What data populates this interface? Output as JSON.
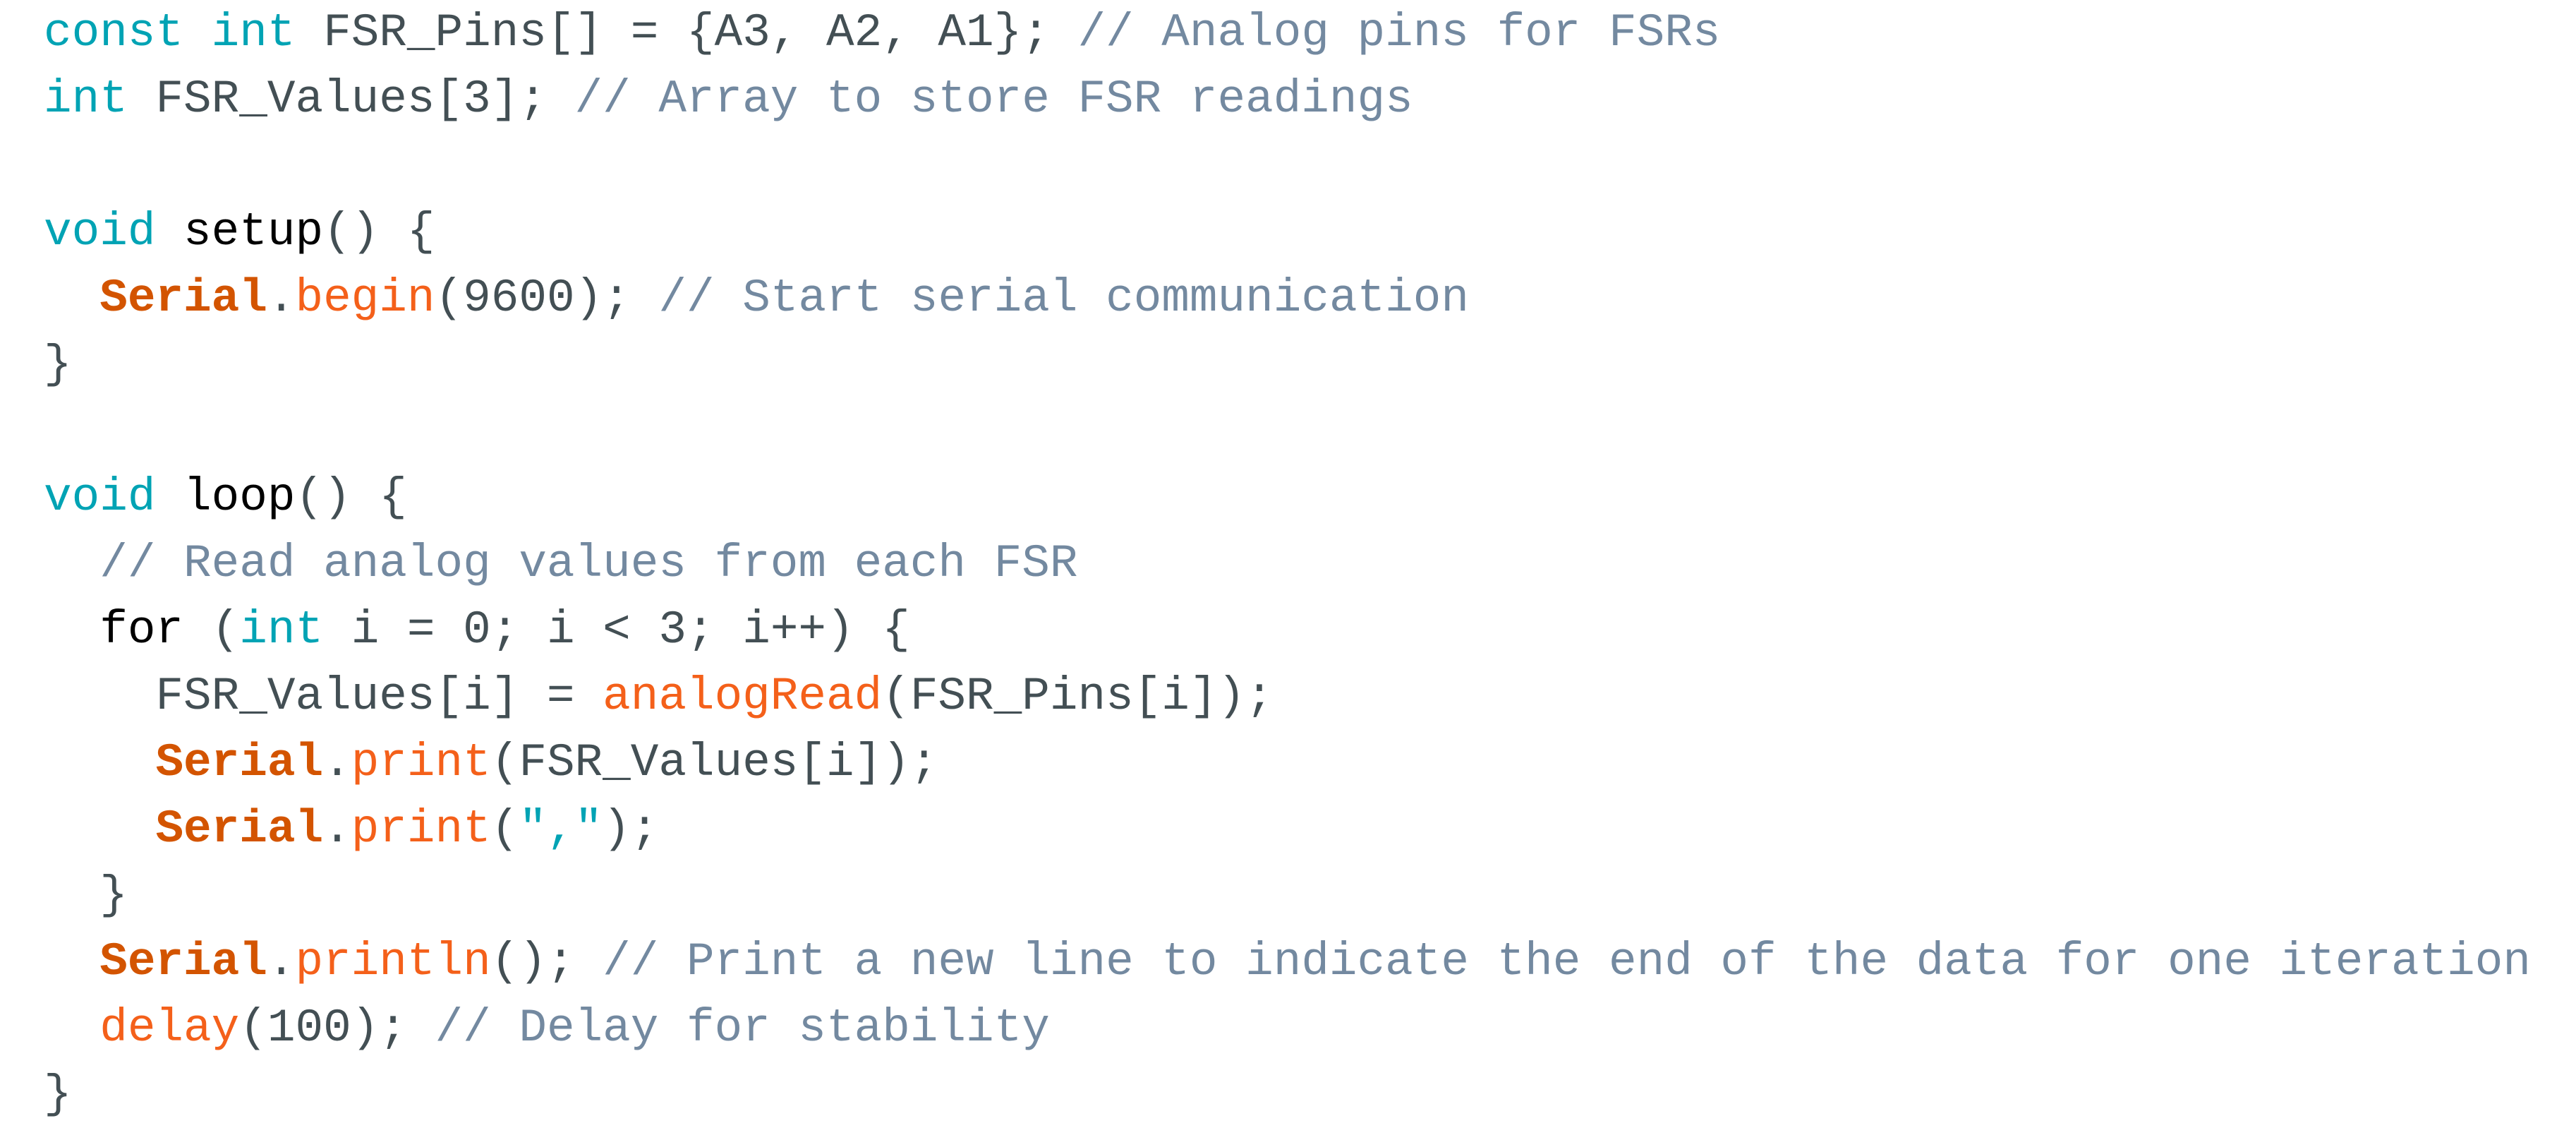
{
  "editor": {
    "language": "arduino-cpp",
    "background_color": "#ffffff",
    "colors": {
      "keyword": "#00A3B4",
      "function": "#7E7D2F",
      "plain": "#434f54",
      "comment": "#7389a0",
      "object": "#d35400",
      "method": "#f4601a",
      "string": "#00A3B4",
      "number": "#434f54"
    }
  },
  "code": {
    "lines": [
      {
        "id": "line-1",
        "tokens": [
          {
            "text": "const",
            "type": "keyword"
          },
          {
            "text": " ",
            "type": "plain"
          },
          {
            "text": "int",
            "type": "keyword"
          },
          {
            "text": " FSR_Pins[] = {A3, A2, A1}; ",
            "type": "plain"
          },
          {
            "text": "// Analog pins for FSRs",
            "type": "comment"
          }
        ]
      },
      {
        "id": "line-2",
        "tokens": [
          {
            "text": "int",
            "type": "keyword"
          },
          {
            "text": " FSR_Values[3]; ",
            "type": "plain"
          },
          {
            "text": "// Array to store FSR readings",
            "type": "comment"
          }
        ]
      },
      {
        "id": "line-3",
        "tokens": []
      },
      {
        "id": "line-4",
        "tokens": [
          {
            "text": "void",
            "type": "keyword"
          },
          {
            "text": " ",
            "type": "plain"
          },
          {
            "text": "setup",
            "type": "function"
          },
          {
            "text": "() {",
            "type": "plain"
          }
        ]
      },
      {
        "id": "line-5",
        "tokens": [
          {
            "text": "  ",
            "type": "plain"
          },
          {
            "text": "Serial",
            "type": "object"
          },
          {
            "text": ".",
            "type": "plain"
          },
          {
            "text": "begin",
            "type": "method"
          },
          {
            "text": "(",
            "type": "plain"
          },
          {
            "text": "9600",
            "type": "number"
          },
          {
            "text": "); ",
            "type": "plain"
          },
          {
            "text": "// Start serial communication",
            "type": "comment"
          }
        ]
      },
      {
        "id": "line-6",
        "tokens": [
          {
            "text": "}",
            "type": "plain"
          }
        ]
      },
      {
        "id": "line-7",
        "tokens": []
      },
      {
        "id": "line-8",
        "tokens": [
          {
            "text": "void",
            "type": "keyword"
          },
          {
            "text": " ",
            "type": "plain"
          },
          {
            "text": "loop",
            "type": "function"
          },
          {
            "text": "() {",
            "type": "plain"
          }
        ]
      },
      {
        "id": "line-9",
        "tokens": [
          {
            "text": "  ",
            "type": "plain"
          },
          {
            "text": "// Read analog values from each FSR",
            "type": "comment"
          }
        ]
      },
      {
        "id": "line-10",
        "tokens": [
          {
            "text": "  ",
            "type": "plain"
          },
          {
            "text": "for",
            "type": "function"
          },
          {
            "text": " (",
            "type": "plain"
          },
          {
            "text": "int",
            "type": "keyword"
          },
          {
            "text": " i = ",
            "type": "plain"
          },
          {
            "text": "0",
            "type": "number"
          },
          {
            "text": "; i < ",
            "type": "plain"
          },
          {
            "text": "3",
            "type": "number"
          },
          {
            "text": "; i++) {",
            "type": "plain"
          }
        ]
      },
      {
        "id": "line-11",
        "tokens": [
          {
            "text": "    FSR_Values[i] = ",
            "type": "plain"
          },
          {
            "text": "analogRead",
            "type": "method"
          },
          {
            "text": "(FSR_Pins[i]);",
            "type": "plain"
          }
        ]
      },
      {
        "id": "line-12",
        "tokens": [
          {
            "text": "    ",
            "type": "plain"
          },
          {
            "text": "Serial",
            "type": "object"
          },
          {
            "text": ".",
            "type": "plain"
          },
          {
            "text": "print",
            "type": "method"
          },
          {
            "text": "(FSR_Values[i]);",
            "type": "plain"
          }
        ]
      },
      {
        "id": "line-13",
        "tokens": [
          {
            "text": "    ",
            "type": "plain"
          },
          {
            "text": "Serial",
            "type": "object"
          },
          {
            "text": ".",
            "type": "plain"
          },
          {
            "text": "print",
            "type": "method"
          },
          {
            "text": "(",
            "type": "plain"
          },
          {
            "text": "\",\"",
            "type": "string"
          },
          {
            "text": ");",
            "type": "plain"
          }
        ]
      },
      {
        "id": "line-14",
        "tokens": [
          {
            "text": "  }",
            "type": "plain"
          }
        ]
      },
      {
        "id": "line-15",
        "tokens": [
          {
            "text": "  ",
            "type": "plain"
          },
          {
            "text": "Serial",
            "type": "object"
          },
          {
            "text": ".",
            "type": "plain"
          },
          {
            "text": "println",
            "type": "method"
          },
          {
            "text": "(); ",
            "type": "plain"
          },
          {
            "text": "// Print a new line to indicate the end of the data for one iteration",
            "type": "comment"
          }
        ]
      },
      {
        "id": "line-16",
        "tokens": [
          {
            "text": "  ",
            "type": "plain"
          },
          {
            "text": "delay",
            "type": "method"
          },
          {
            "text": "(",
            "type": "plain"
          },
          {
            "text": "100",
            "type": "number"
          },
          {
            "text": "); ",
            "type": "plain"
          },
          {
            "text": "// Delay for stability",
            "type": "comment"
          }
        ]
      },
      {
        "id": "line-17",
        "tokens": [
          {
            "text": "}",
            "type": "plain"
          }
        ]
      }
    ]
  }
}
